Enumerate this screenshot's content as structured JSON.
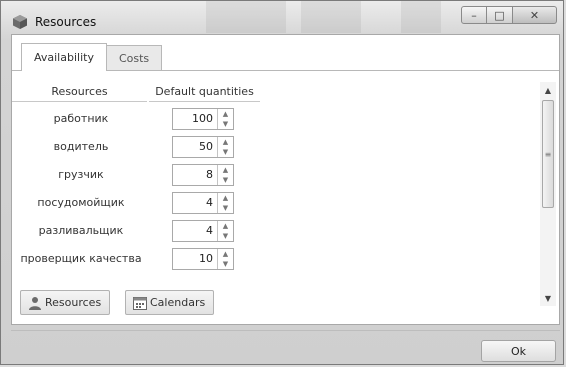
{
  "window": {
    "title": "Resources",
    "controls": {
      "minimize": "–",
      "maximize": "□",
      "close": "✕"
    }
  },
  "tabs": [
    {
      "label": "Availability",
      "active": true
    },
    {
      "label": "Costs",
      "active": false
    }
  ],
  "table": {
    "columns": {
      "resources": "Resources",
      "default_quantities": "Default quantities"
    },
    "rows": [
      {
        "resource": "работник",
        "quantity": "100"
      },
      {
        "resource": "водитель",
        "quantity": "50"
      },
      {
        "resource": "грузчик",
        "quantity": "8"
      },
      {
        "resource": "посудомойщик",
        "quantity": "4"
      },
      {
        "resource": "разливальщик",
        "quantity": "4"
      },
      {
        "resource": "проверщик качества",
        "quantity": "10"
      }
    ]
  },
  "buttons": {
    "resources": "Resources",
    "calendars": "Calendars",
    "ok": "Ok"
  },
  "icons": {
    "app": "cube-icon",
    "resources": "user-icon",
    "calendars": "calendar-icon"
  },
  "colors": {
    "window_bg": "#dcdcdc",
    "content_bg": "#ffffff",
    "border": "#a8a8a8",
    "app_icon": "#6b6b6b"
  }
}
